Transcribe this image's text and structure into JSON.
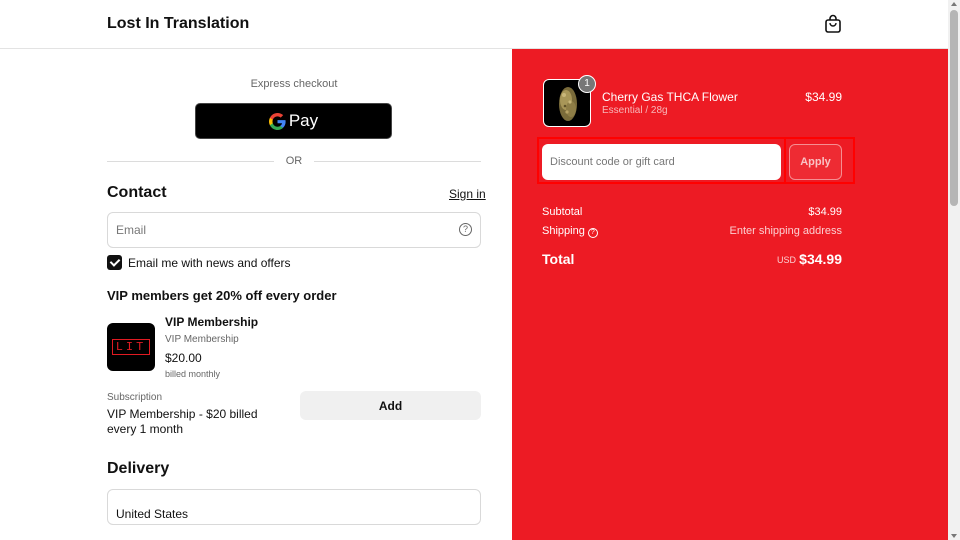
{
  "header": {
    "brand": "Lost In Translation",
    "cart_icon": "shopping-bag-icon"
  },
  "checkout": {
    "express_label": "Express checkout",
    "gpay_label": "Pay",
    "or_label": "OR",
    "contact": {
      "title": "Contact",
      "signin_label": "Sign in",
      "email_placeholder": "Email",
      "email_value": "",
      "help_icon": "question-circle-icon",
      "newsletter_label": "Email me with news and offers",
      "newsletter_checked": true
    },
    "vip": {
      "title": "VIP members get 20% off every order",
      "logo_text": "LIT",
      "name": "VIP Membership",
      "subtitle": "VIP Membership",
      "price": "$20.00",
      "billed": "billed monthly",
      "subscription_label": "Subscription",
      "subscription_desc": "VIP Membership - $20 billed every 1 month",
      "add_label": "Add"
    },
    "delivery": {
      "title": "Delivery",
      "country": "United States"
    }
  },
  "summary": {
    "product": {
      "name": "Cherry Gas THCA Flower",
      "variant": "Essential / 28g",
      "price": "$34.99",
      "quantity": "1"
    },
    "discount_placeholder": "Discount code or gift card",
    "discount_value": "",
    "apply_label": "Apply",
    "subtotal_label": "Subtotal",
    "subtotal_value": "$34.99",
    "shipping_label": "Shipping",
    "shipping_value": "Enter shipping address",
    "total_label": "Total",
    "currency": "USD",
    "total_value": "$34.99"
  },
  "colors": {
    "summary_bg": "#ed1b24",
    "highlight": "#ff0000"
  }
}
